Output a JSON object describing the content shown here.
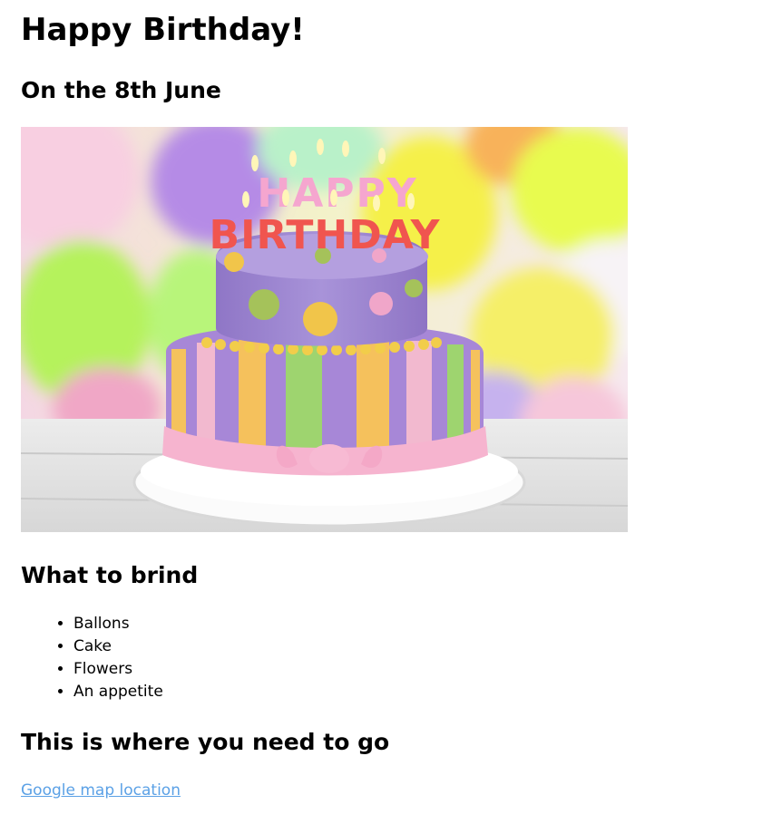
{
  "page": {
    "title": "Happy Birthday!",
    "subtitle": "On the 8th June"
  },
  "hero_image": {
    "alt_description": "birthday-cake-photo",
    "cake_lettering_top": "HAPPY",
    "cake_lettering_bottom": "BIRTHDAY"
  },
  "bring_section": {
    "heading": "What to brind",
    "items": [
      "Ballons",
      "Cake",
      "Flowers",
      "An appetite"
    ]
  },
  "location_section": {
    "heading": "This is where you need to go",
    "link_text": "Google map location",
    "link_color": "#5ba1e6"
  }
}
